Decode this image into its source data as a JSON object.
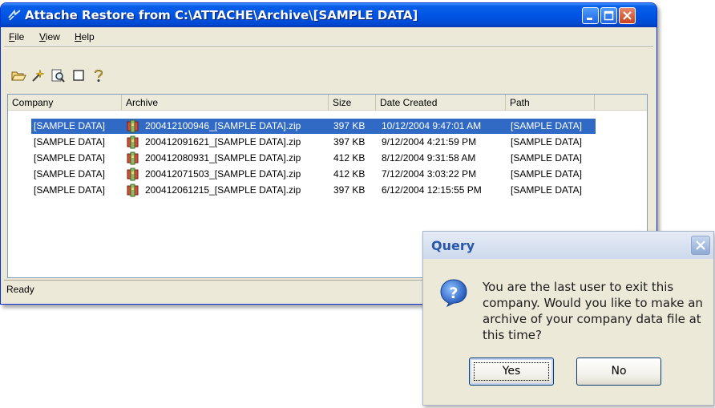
{
  "window": {
    "title": "Attache Restore from C:\\ATTACHE\\Archive\\[SAMPLE DATA]",
    "menu": [
      "File",
      "View",
      "Help"
    ],
    "toolbar": [
      "open-folder-icon",
      "wand-icon",
      "find-icon",
      "blank-icon",
      "help-icon"
    ],
    "columns": [
      "Company",
      "Archive",
      "Size",
      "Date Created",
      "Path"
    ],
    "rows": [
      {
        "company": "[SAMPLE DATA]",
        "archive": "200412100946_[SAMPLE DATA].zip",
        "size": "397 KB",
        "date": "10/12/2004 9:47:01 AM",
        "path": "[SAMPLE DATA]",
        "selected": true
      },
      {
        "company": "[SAMPLE DATA]",
        "archive": "200412091621_[SAMPLE DATA].zip",
        "size": "397 KB",
        "date": "9/12/2004 4:21:59 PM",
        "path": "[SAMPLE DATA]",
        "selected": false
      },
      {
        "company": "[SAMPLE DATA]",
        "archive": "200412080931_[SAMPLE DATA].zip",
        "size": "412 KB",
        "date": "8/12/2004 9:31:58 AM",
        "path": "[SAMPLE DATA]",
        "selected": false
      },
      {
        "company": "[SAMPLE DATA]",
        "archive": "200412071503_[SAMPLE DATA].zip",
        "size": "412 KB",
        "date": "7/12/2004 3:03:22 PM",
        "path": "[SAMPLE DATA]",
        "selected": false
      },
      {
        "company": "[SAMPLE DATA]",
        "archive": "200412061215_[SAMPLE DATA].zip",
        "size": "397 KB",
        "date": "6/12/2004 12:15:55 PM",
        "path": "[SAMPLE DATA]",
        "selected": false
      }
    ],
    "status": "Ready"
  },
  "dialog": {
    "title": "Query",
    "message": "You are the last user to exit this company. Would you like to make an archive of your company data file at this time?",
    "yes_label": "Yes",
    "no_label": "No"
  },
  "colors": {
    "title_blue": "#0055e5",
    "selection": "#316ac5",
    "dialog_title": "#2a58a8"
  }
}
